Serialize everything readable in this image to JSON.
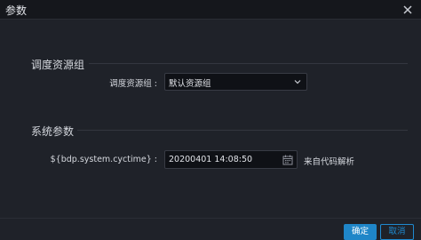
{
  "dialog": {
    "title": "参数",
    "close_icon": "close-icon"
  },
  "resource_section": {
    "title": "调度资源组",
    "field_label": "调度资源组 :",
    "selected_value": "默认资源组",
    "dropdown_icon": "chevron-down-icon"
  },
  "system_section": {
    "title": "系统参数",
    "field_label": "${bdp.system.cyctime} :",
    "datetime_value": "20200401 14:08:50",
    "calendar_icon": "calendar-icon",
    "parse_link": "来自代码解析"
  },
  "footer": {
    "confirm_label": "确定",
    "cancel_label": "取消"
  },
  "colors": {
    "accent": "#1f86c8",
    "background": "#1f2229"
  }
}
